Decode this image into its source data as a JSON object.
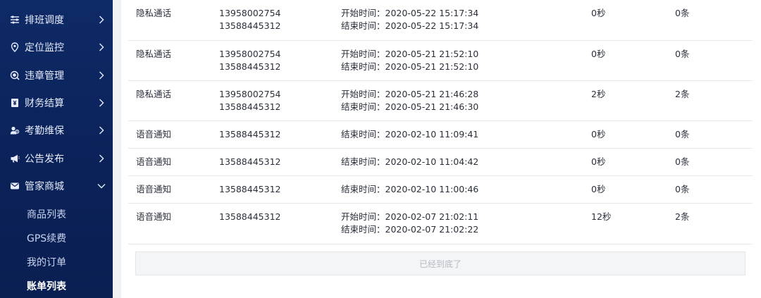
{
  "sidebar": {
    "menu": [
      {
        "label": "排班调度",
        "icon": "sliders-icon",
        "expanded": false
      },
      {
        "label": "定位监控",
        "icon": "location-pin-icon",
        "expanded": false
      },
      {
        "label": "违章管理",
        "icon": "search-badge-icon",
        "expanded": false
      },
      {
        "label": "财务结算",
        "icon": "receipt-icon",
        "expanded": false
      },
      {
        "label": "考勤维保",
        "icon": "users-icon",
        "expanded": false
      },
      {
        "label": "公告发布",
        "icon": "megaphone-icon",
        "expanded": false
      },
      {
        "label": "管家商城",
        "icon": "envelope-icon",
        "expanded": true
      }
    ],
    "submenu": [
      {
        "label": "商品列表",
        "active": false
      },
      {
        "label": "GPS续费",
        "active": false
      },
      {
        "label": "我的订单",
        "active": false
      },
      {
        "label": "账单列表",
        "active": true
      }
    ]
  },
  "records": [
    {
      "type": "隐私通话",
      "phones": [
        "13958002754",
        "13588445312"
      ],
      "times": [
        "开始时间：2020-05-22 15:17:34",
        "结束时间：2020-05-22 15:17:34"
      ],
      "duration": "0秒",
      "count": "0条"
    },
    {
      "type": "隐私通话",
      "phones": [
        "13958002754",
        "13588445312"
      ],
      "times": [
        "开始时间：2020-05-21 21:52:10",
        "结束时间：2020-05-21 21:52:10"
      ],
      "duration": "0秒",
      "count": "0条"
    },
    {
      "type": "隐私通话",
      "phones": [
        "13958002754",
        "13588445312"
      ],
      "times": [
        "开始时间：2020-05-21 21:46:28",
        "结束时间：2020-05-21 21:46:30"
      ],
      "duration": "2秒",
      "count": "2条"
    },
    {
      "type": "语音通知",
      "phones": [
        "13588445312"
      ],
      "times": [
        "结束时间：2020-02-10 11:09:41"
      ],
      "duration": "0秒",
      "count": "0条"
    },
    {
      "type": "语音通知",
      "phones": [
        "13588445312"
      ],
      "times": [
        "结束时间：2020-02-10 11:04:42"
      ],
      "duration": "0秒",
      "count": "0条"
    },
    {
      "type": "语音通知",
      "phones": [
        "13588445312"
      ],
      "times": [
        "结束时间：2020-02-10 11:00:46"
      ],
      "duration": "0秒",
      "count": "0条"
    },
    {
      "type": "语音通知",
      "phones": [
        "13588445312"
      ],
      "times": [
        "开始时间：2020-02-07 21:02:11",
        "结束时间：2020-02-07 21:02:22"
      ],
      "duration": "12秒",
      "count": "2条"
    }
  ],
  "footer": {
    "end_text": "已经到底了"
  },
  "colors": {
    "sidebar_bg": "#0b2259",
    "text": "#2a2f3a",
    "muted": "#b5b9c2"
  }
}
